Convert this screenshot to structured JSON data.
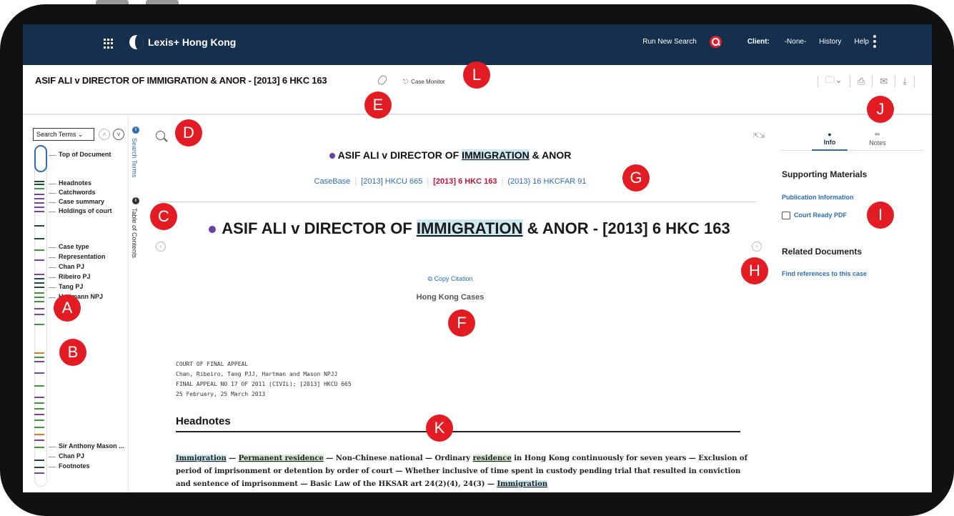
{
  "app": {
    "brand": "Lexis+",
    "brand_region": "Hong Kong"
  },
  "topnav": {
    "run_new_search": "Run New Search",
    "client_label": "Client:",
    "client_value": "-None-",
    "history": "History",
    "help": "Help"
  },
  "doc_header": {
    "title": "ASIF ALI v DIRECTOR OF IMMIGRATION & ANOR - [2013] 6 HKC 163",
    "case_monitor": "Case Monitor"
  },
  "left_nav": {
    "search_terms_select": "Search Terms",
    "toc": [
      "Top of Document",
      "Headnotes",
      "Catchwords",
      "Case summary",
      "Holdings of court",
      "Case type",
      "Representation",
      "Chan PJ",
      "Ribeiro PJ",
      "Tang PJ",
      "Hartmann NPJ",
      "Sir Anthony Mason ...",
      "Chan PJ",
      "Footnotes"
    ]
  },
  "side_tabs": {
    "search_terms": "Search Terms",
    "table_of_contents": "Table of Contents"
  },
  "document": {
    "small_title_pre": "ASIF ALI v DIRECTOR OF ",
    "small_title_hl": "IMMIGRATION",
    "small_title_post": " & ANOR",
    "citations": {
      "c1": "CaseBase",
      "c2": "[2013] HKCU 665",
      "c3": "[2013] 6 HKC 163",
      "c4": "(2013) 16 HKCFAR 91"
    },
    "big_title_pre": "ASIF ALI v DIRECTOR OF ",
    "big_title_hl": "IMMIGRATION",
    "big_title_post": " & ANOR - [2013] 6 HKC 163",
    "copy_citation": "Copy Citation",
    "report_type": "Hong Kong Cases",
    "court_info": {
      "line1": "COURT OF FINAL APPEAL",
      "line2": "Chan, Ribeiro, Tang PJJ, Hartman and Mason NPJJ",
      "line3": "FINAL APPEAL NO 17 OF 2011 (CIVIL); [2013] HKCU 665",
      "line4": "25 February, 25 March 2013"
    },
    "section_heading": "Headnotes",
    "catchwords": {
      "t1": "Immigration",
      "t2": " — ",
      "t3": "Permanent residence",
      "t4": " — Non-Chinese national — Ordinary ",
      "t5": "residence",
      "t6": " in Hong Kong continuously for seven years — Exclusion of period of imprisonment or detention by order of court — Whether inclusive of time spent in custody pending trial that resulted in conviction and sentence of imprisonment — Basic Law of the HKSAR art 24(2)(4), 24(3) — ",
      "t7": "Immigration"
    }
  },
  "right_panel": {
    "tab_info": "Info",
    "tab_notes": "Notes",
    "supporting_materials": "Supporting Materials",
    "publication_information": "Publication Information",
    "court_ready_pdf": "Court Ready PDF",
    "related_documents": "Related Documents",
    "find_references": "Find references to this case"
  },
  "callouts": {
    "a": "A",
    "b": "B",
    "c": "C",
    "d": "D",
    "e": "E",
    "f": "F",
    "g": "G",
    "h": "H",
    "i": "I",
    "j": "J",
    "k": "K",
    "l": "L"
  },
  "colors": {
    "nav_bg": "#14304d",
    "accent_red": "#e31b23",
    "link_blue": "#2a6ebb",
    "highlight_blue": "#cde9f2",
    "highlight_green": "#d6ebd2"
  }
}
